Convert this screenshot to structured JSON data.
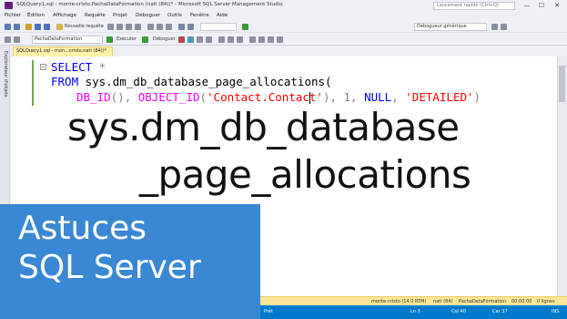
{
  "window": {
    "title": "SQLQuery1.sql - monte-cristo.PachaDataFormation (nati (84))* - Microsoft SQL Server Management Studio",
    "quick_launch_placeholder": "Lancement rapide (Ctrl+Q)",
    "minimize": "—",
    "maximize": "☐",
    "close": "✕"
  },
  "menu": [
    "Fichier",
    "Édition",
    "Affichage",
    "Requête",
    "Projet",
    "Déboguer",
    "Outils",
    "Fenêtre",
    "Aide"
  ],
  "toolbar": {
    "new_query": "Nouvelle requête",
    "database": "PachaDataFormation",
    "execute": "Exécuter",
    "debug": "Déboguer",
    "generic_debugger": "Débogueur générique"
  },
  "side_panel_label": "Explorateur d'objets",
  "editor_tab": "SQLQuery1.sql - mon...cristo.nati (84))*",
  "code": {
    "line1": {
      "kw": "SELECT",
      "sym": " *"
    },
    "line2": {
      "kw": "FROM",
      "plain": " sys.dm_db_database_page_allocations("
    },
    "line3": {
      "fn1": "DB_ID",
      "p1": "(), ",
      "fn2": "OBJECT_ID",
      "p2": "(",
      "str1": "'Contact.Contact'",
      "p3": "), 1, ",
      "kw1": "NULL",
      "p4": ", ",
      "str2": "'DETAILED'",
      "p5": ")"
    }
  },
  "overlay": {
    "line1": "sys.dm_db_database",
    "line2": "_page_allocations"
  },
  "banner": {
    "line1": "Astuces",
    "line2": "SQL Server"
  },
  "status_info": {
    "server": "monte-cristo (14.0 RTM)",
    "user": "nati (84)",
    "database": "PachaDataFormation",
    "time": "00:00:00",
    "rows": "0 lignes"
  },
  "status": {
    "ready": "Prêt",
    "line": "Ln 3",
    "col": "Col 40",
    "char": "Car 37",
    "mode": "INS"
  },
  "colors": {
    "banner": "#2b7fd0",
    "statusbar": "#007acc",
    "keyword": "#0000ff",
    "function": "#ff00ff",
    "string": "#ff0000"
  }
}
